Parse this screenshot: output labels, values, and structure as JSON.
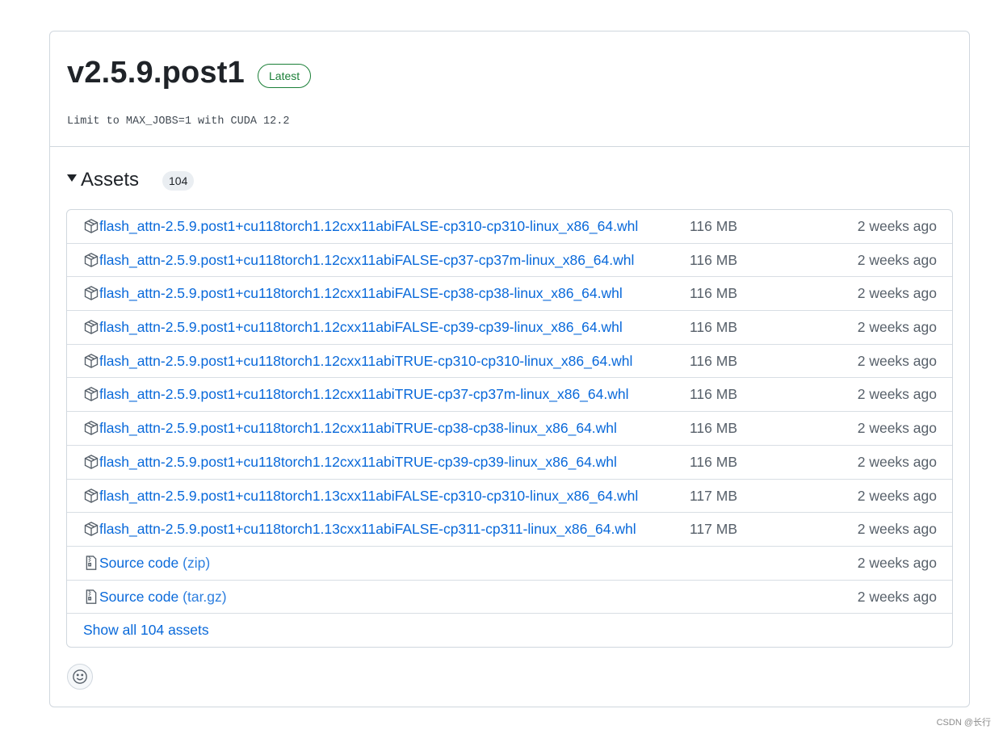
{
  "release": {
    "title": "v2.5.9.post1",
    "badge": "Latest",
    "body": "Limit to MAX_JOBS=1 with CUDA 12.2"
  },
  "assets": {
    "heading": "Assets",
    "count": "104",
    "show_all": "Show all 104 assets",
    "items": [
      {
        "name": "flash_attn-2.5.9.post1+cu118torch1.12cxx11abiFALSE-cp310-cp310-linux_x86_64.whl",
        "size": "116 MB",
        "date": "2 weeks ago",
        "icon": "package-icon"
      },
      {
        "name": "flash_attn-2.5.9.post1+cu118torch1.12cxx11abiFALSE-cp37-cp37m-linux_x86_64.whl",
        "size": "116 MB",
        "date": "2 weeks ago",
        "icon": "package-icon"
      },
      {
        "name": "flash_attn-2.5.9.post1+cu118torch1.12cxx11abiFALSE-cp38-cp38-linux_x86_64.whl",
        "size": "116 MB",
        "date": "2 weeks ago",
        "icon": "package-icon"
      },
      {
        "name": "flash_attn-2.5.9.post1+cu118torch1.12cxx11abiFALSE-cp39-cp39-linux_x86_64.whl",
        "size": "116 MB",
        "date": "2 weeks ago",
        "icon": "package-icon"
      },
      {
        "name": "flash_attn-2.5.9.post1+cu118torch1.12cxx11abiTRUE-cp310-cp310-linux_x86_64.whl",
        "size": "116 MB",
        "date": "2 weeks ago",
        "icon": "package-icon"
      },
      {
        "name": "flash_attn-2.5.9.post1+cu118torch1.12cxx11abiTRUE-cp37-cp37m-linux_x86_64.whl",
        "size": "116 MB",
        "date": "2 weeks ago",
        "icon": "package-icon"
      },
      {
        "name": "flash_attn-2.5.9.post1+cu118torch1.12cxx11abiTRUE-cp38-cp38-linux_x86_64.whl",
        "size": "116 MB",
        "date": "2 weeks ago",
        "icon": "package-icon"
      },
      {
        "name": "flash_attn-2.5.9.post1+cu118torch1.12cxx11abiTRUE-cp39-cp39-linux_x86_64.whl",
        "size": "116 MB",
        "date": "2 weeks ago",
        "icon": "package-icon"
      },
      {
        "name": "flash_attn-2.5.9.post1+cu118torch1.13cxx11abiFALSE-cp310-cp310-linux_x86_64.whl",
        "size": "117 MB",
        "date": "2 weeks ago",
        "icon": "package-icon"
      },
      {
        "name": "flash_attn-2.5.9.post1+cu118torch1.13cxx11abiFALSE-cp311-cp311-linux_x86_64.whl",
        "size": "117 MB",
        "date": "2 weeks ago",
        "icon": "package-icon"
      }
    ],
    "source": [
      {
        "label": "Source code",
        "format": "(zip)",
        "date": "2 weeks ago",
        "icon": "file-zip-icon"
      },
      {
        "label": "Source code",
        "format": "(tar.gz)",
        "date": "2 weeks ago",
        "icon": "file-zip-icon"
      }
    ]
  },
  "reaction": {
    "icon": "smiley-icon"
  },
  "watermark": "CSDN @长行",
  "colors": {
    "link": "#0969da",
    "muted": "#57606a",
    "badge": "#1a7f37",
    "border": "#d0d7de"
  }
}
